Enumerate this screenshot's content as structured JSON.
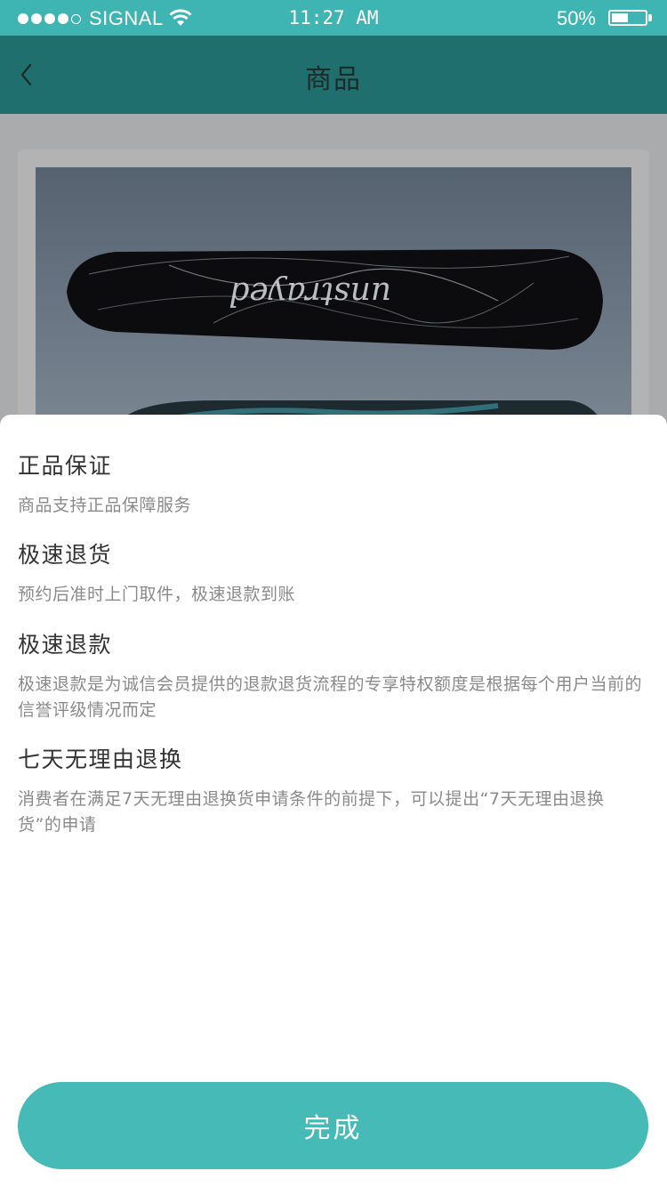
{
  "status_bar": {
    "carrier": "SIGNAL",
    "time": "11:27 AM",
    "battery": "50%",
    "battery_level": 0.5
  },
  "nav": {
    "title": "商品",
    "back_icon": "chevron-left-icon"
  },
  "product": {
    "image": "snowboard-image",
    "board_text": "unstrayed"
  },
  "services": [
    {
      "title": "正品保证",
      "desc": "商品支持正品保障服务"
    },
    {
      "title": "极速退货",
      "desc": "预约后准时上门取件，极速退款到账"
    },
    {
      "title": "极速退款",
      "desc": "极速退款是为诚信会员提供的退款退货流程的专享特权额度是根据每个用户当前的信誉评级情况而定"
    },
    {
      "title": "七天无理由退换",
      "desc": "消费者在满足7天无理由退换货申请条件的前提下，可以提出“7天无理由退换货”的申请"
    }
  ],
  "done_label": "完成",
  "colors": {
    "accent": "#45bab6",
    "status_bar": "#3fb5b3",
    "nav_dimmed": "#1f6f6e"
  }
}
